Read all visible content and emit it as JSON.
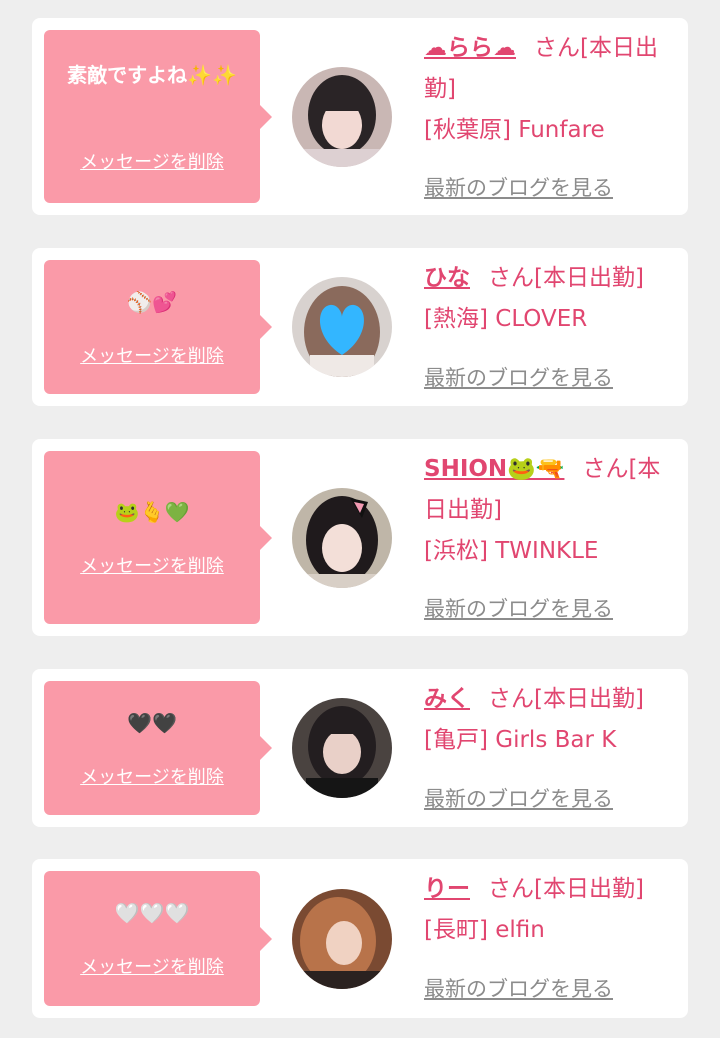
{
  "delete_label": "メッセージを削除",
  "blog_label": "最新のブログを見る",
  "suffix_label": "さん[本日出勤]",
  "entries": [
    {
      "message": "素敵ですよね✨️✨",
      "name": "☁らら☁",
      "shop": "[秋葉原] Funfare"
    },
    {
      "message": "⚾💕",
      "name": "ひな",
      "shop": "[熱海] CLOVER"
    },
    {
      "message": "🐸🫰💚",
      "name": "SHION🐸🔫",
      "shop": "[浜松] TWINKLE"
    },
    {
      "message": "🖤🖤",
      "name": "みく",
      "shop": "[亀戸] Girls Bar K"
    },
    {
      "message": "🤍🤍🤍",
      "name": "りー",
      "shop": "[長町] elfin"
    }
  ]
}
